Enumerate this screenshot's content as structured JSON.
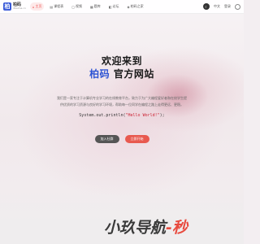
{
  "header": {
    "logo_mark": "柏",
    "logo_title": "柏码",
    "logo_sub": "itbaima.cn",
    "nav": [
      {
        "icon": "⌂",
        "label": "主页",
        "active": true
      },
      {
        "icon": "▤",
        "label": "课程表"
      },
      {
        "icon": "▢",
        "label": "视频"
      },
      {
        "icon": "▦",
        "label": "题库"
      },
      {
        "icon": "◧",
        "label": "论坛"
      },
      {
        "icon": "◈",
        "label": "柏码之家"
      }
    ],
    "right": {
      "mode_icon": "☾",
      "lang_label": "中文",
      "login_label": "登录"
    }
  },
  "hero": {
    "line1": "欢迎来到",
    "brand": "柏码",
    "line2_rest": " 官方网站",
    "description": "我们是一家专注于计算机专业学习的在线教育平台，致力于为广大编程爱好者和在校学生提供优质的学习资源与良好的学习环境，帮助每一位同学在编程之路上走得更远、更稳。",
    "code_prefix": "System.out.println(",
    "code_string": "\"Hello World!\"",
    "code_suffix": ");",
    "btn_primary": "加入社群",
    "btn_secondary": "立即开始"
  },
  "watermark": {
    "part1": "小玖",
    "part2": "导航",
    "part3": "-秒"
  }
}
